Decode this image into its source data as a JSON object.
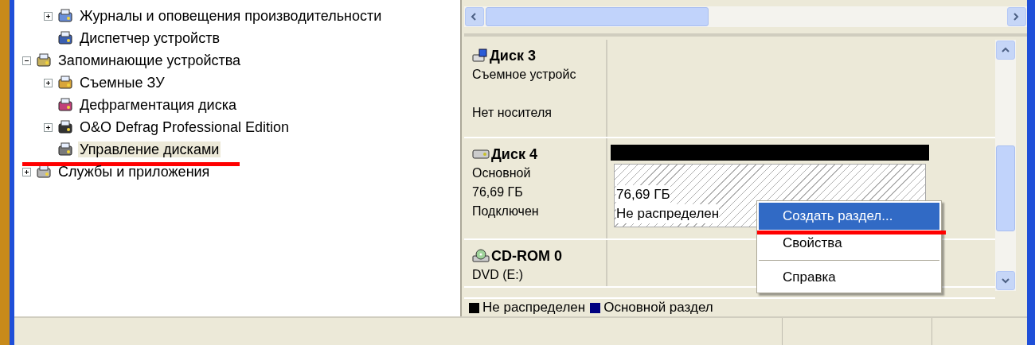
{
  "tree": {
    "continued_children": [
      {
        "label": "Журналы и оповещения производительности",
        "expandable": true,
        "expanded": false,
        "selected": false
      },
      {
        "label": "Диспетчер устройств",
        "expandable": false,
        "selected": false
      }
    ],
    "items": [
      {
        "label": "Запоминающие устройства",
        "expandable": true,
        "expanded": true,
        "selected": false,
        "children": [
          {
            "label": "Съемные ЗУ",
            "expandable": true,
            "expanded": false,
            "selected": false
          },
          {
            "label": "Дефрагментация диска",
            "expandable": false,
            "selected": false
          },
          {
            "label": "O&O Defrag Professional Edition",
            "expandable": true,
            "expanded": false,
            "selected": false
          },
          {
            "label": "Управление дисками",
            "expandable": false,
            "selected": true,
            "annotated": true
          }
        ]
      },
      {
        "label": "Службы и приложения",
        "expandable": true,
        "expanded": false,
        "selected": false
      }
    ]
  },
  "disks": [
    {
      "name": "Диск 3",
      "kind": "removable",
      "type": "Съемное устройс",
      "status": "Нет носителя"
    },
    {
      "name": "Диск 4",
      "kind": "basic",
      "type": "Основной",
      "size": "76,69 ГБ",
      "status": "Подключен",
      "volumes": [
        {
          "kind": "unallocated",
          "size": "76,69 ГБ",
          "label": "Не распределен",
          "selected": true
        }
      ]
    },
    {
      "name": "CD-ROM 0",
      "kind": "cdrom",
      "type": "DVD (E:)"
    }
  ],
  "legend": [
    {
      "label": "Не распределен",
      "color": "#000000"
    },
    {
      "label": "Основной раздел",
      "color": "#000080"
    }
  ],
  "context_menu": [
    {
      "kind": "item",
      "label": "Создать раздел...",
      "selected": true,
      "annotated": true
    },
    {
      "kind": "item",
      "label": "Свойства",
      "selected": false
    },
    {
      "kind": "separator"
    },
    {
      "kind": "item",
      "label": "Справка",
      "selected": false
    }
  ]
}
